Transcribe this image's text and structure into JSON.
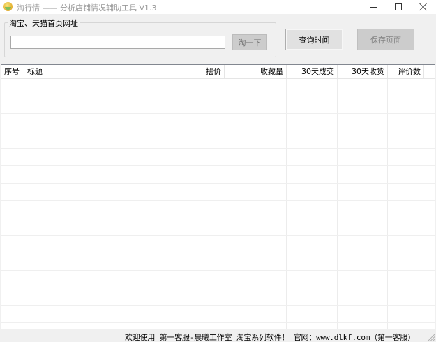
{
  "window": {
    "title": "淘行情 —— 分析店铺情况辅助工具 V1.3"
  },
  "search": {
    "group_label": "淘宝、天猫首页网址",
    "url_value": "",
    "submit_label": "淘一下"
  },
  "toolbar": {
    "query_time_label": "查询时间",
    "save_page_label": "保存页面"
  },
  "table": {
    "columns": [
      "序号",
      "标题",
      "摆价",
      "收藏量",
      "30天成交",
      "30天收货",
      "评价数"
    ],
    "rows": []
  },
  "status": {
    "text": "欢迎使用 第一客服-晨曦工作室 淘宝系列软件！ 官网：www.dlkf.com（第一客服）"
  },
  "colors": {
    "window_bg": "#f0f0f0",
    "disabled_button_bg": "#cccccc",
    "button_bg": "#e1e1e1",
    "title_text": "#9a9a9a"
  },
  "icons": {
    "app": "app-logo-icon",
    "minimize": "minimize-icon",
    "maximize": "maximize-icon",
    "close": "close-icon"
  }
}
